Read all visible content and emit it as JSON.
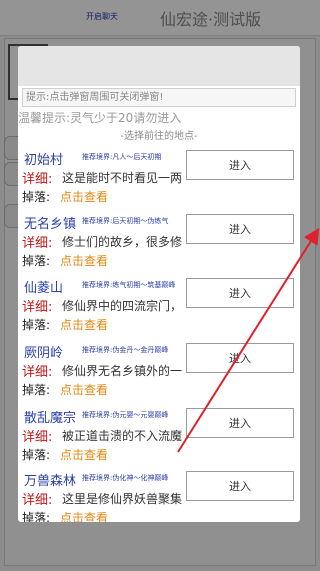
{
  "app": {
    "chat_toggle": "开启聊天",
    "title": "仙宏途·测试版",
    "card_char": "仙"
  },
  "modal": {
    "hint": "提示:点击弹窗周围可关闭弹窗!",
    "warm_tip": "温馨提示:灵气少于20请勿进入",
    "choose_title": "-选择前往的地点-",
    "detail_label": "详细:",
    "drop_label": "掉落:",
    "drop_link": "点击查看",
    "enter_label": "进入",
    "locations": [
      {
        "name": "初始村",
        "realm": "推荐境界:凡人～后天初期",
        "detail": "这是能时不时看见一两只"
      },
      {
        "name": "无名乡镇",
        "realm": "推荐境界:后天初期～伪练气",
        "detail": "修士们的故乡，很多修仙"
      },
      {
        "name": "仙菱山",
        "realm": "推荐境界:练气初期～筑基巅峰",
        "detail": "修仙界中的四流宗门，这"
      },
      {
        "name": "厥阴岭",
        "realm": "推荐境界:伪金丹～金丹巅峰",
        "detail": "修仙界无名乡镇外的一片"
      },
      {
        "name": "散乱魔宗",
        "realm": "推荐境界:伪元婴～元婴巅峰",
        "detail": "被正道击溃的不入流魔宗"
      },
      {
        "name": "万兽森林",
        "realm": "推荐境界:伪化神～化神巅峰",
        "detail": "这里是修仙界妖兽聚集之"
      }
    ]
  },
  "colors": {
    "location_name": "#2c41a8",
    "detail_label": "#c01818",
    "drop_link": "#e08a14",
    "arrow": "#e0202a"
  },
  "icons": {
    "annotation": "red-arrow-icon"
  }
}
